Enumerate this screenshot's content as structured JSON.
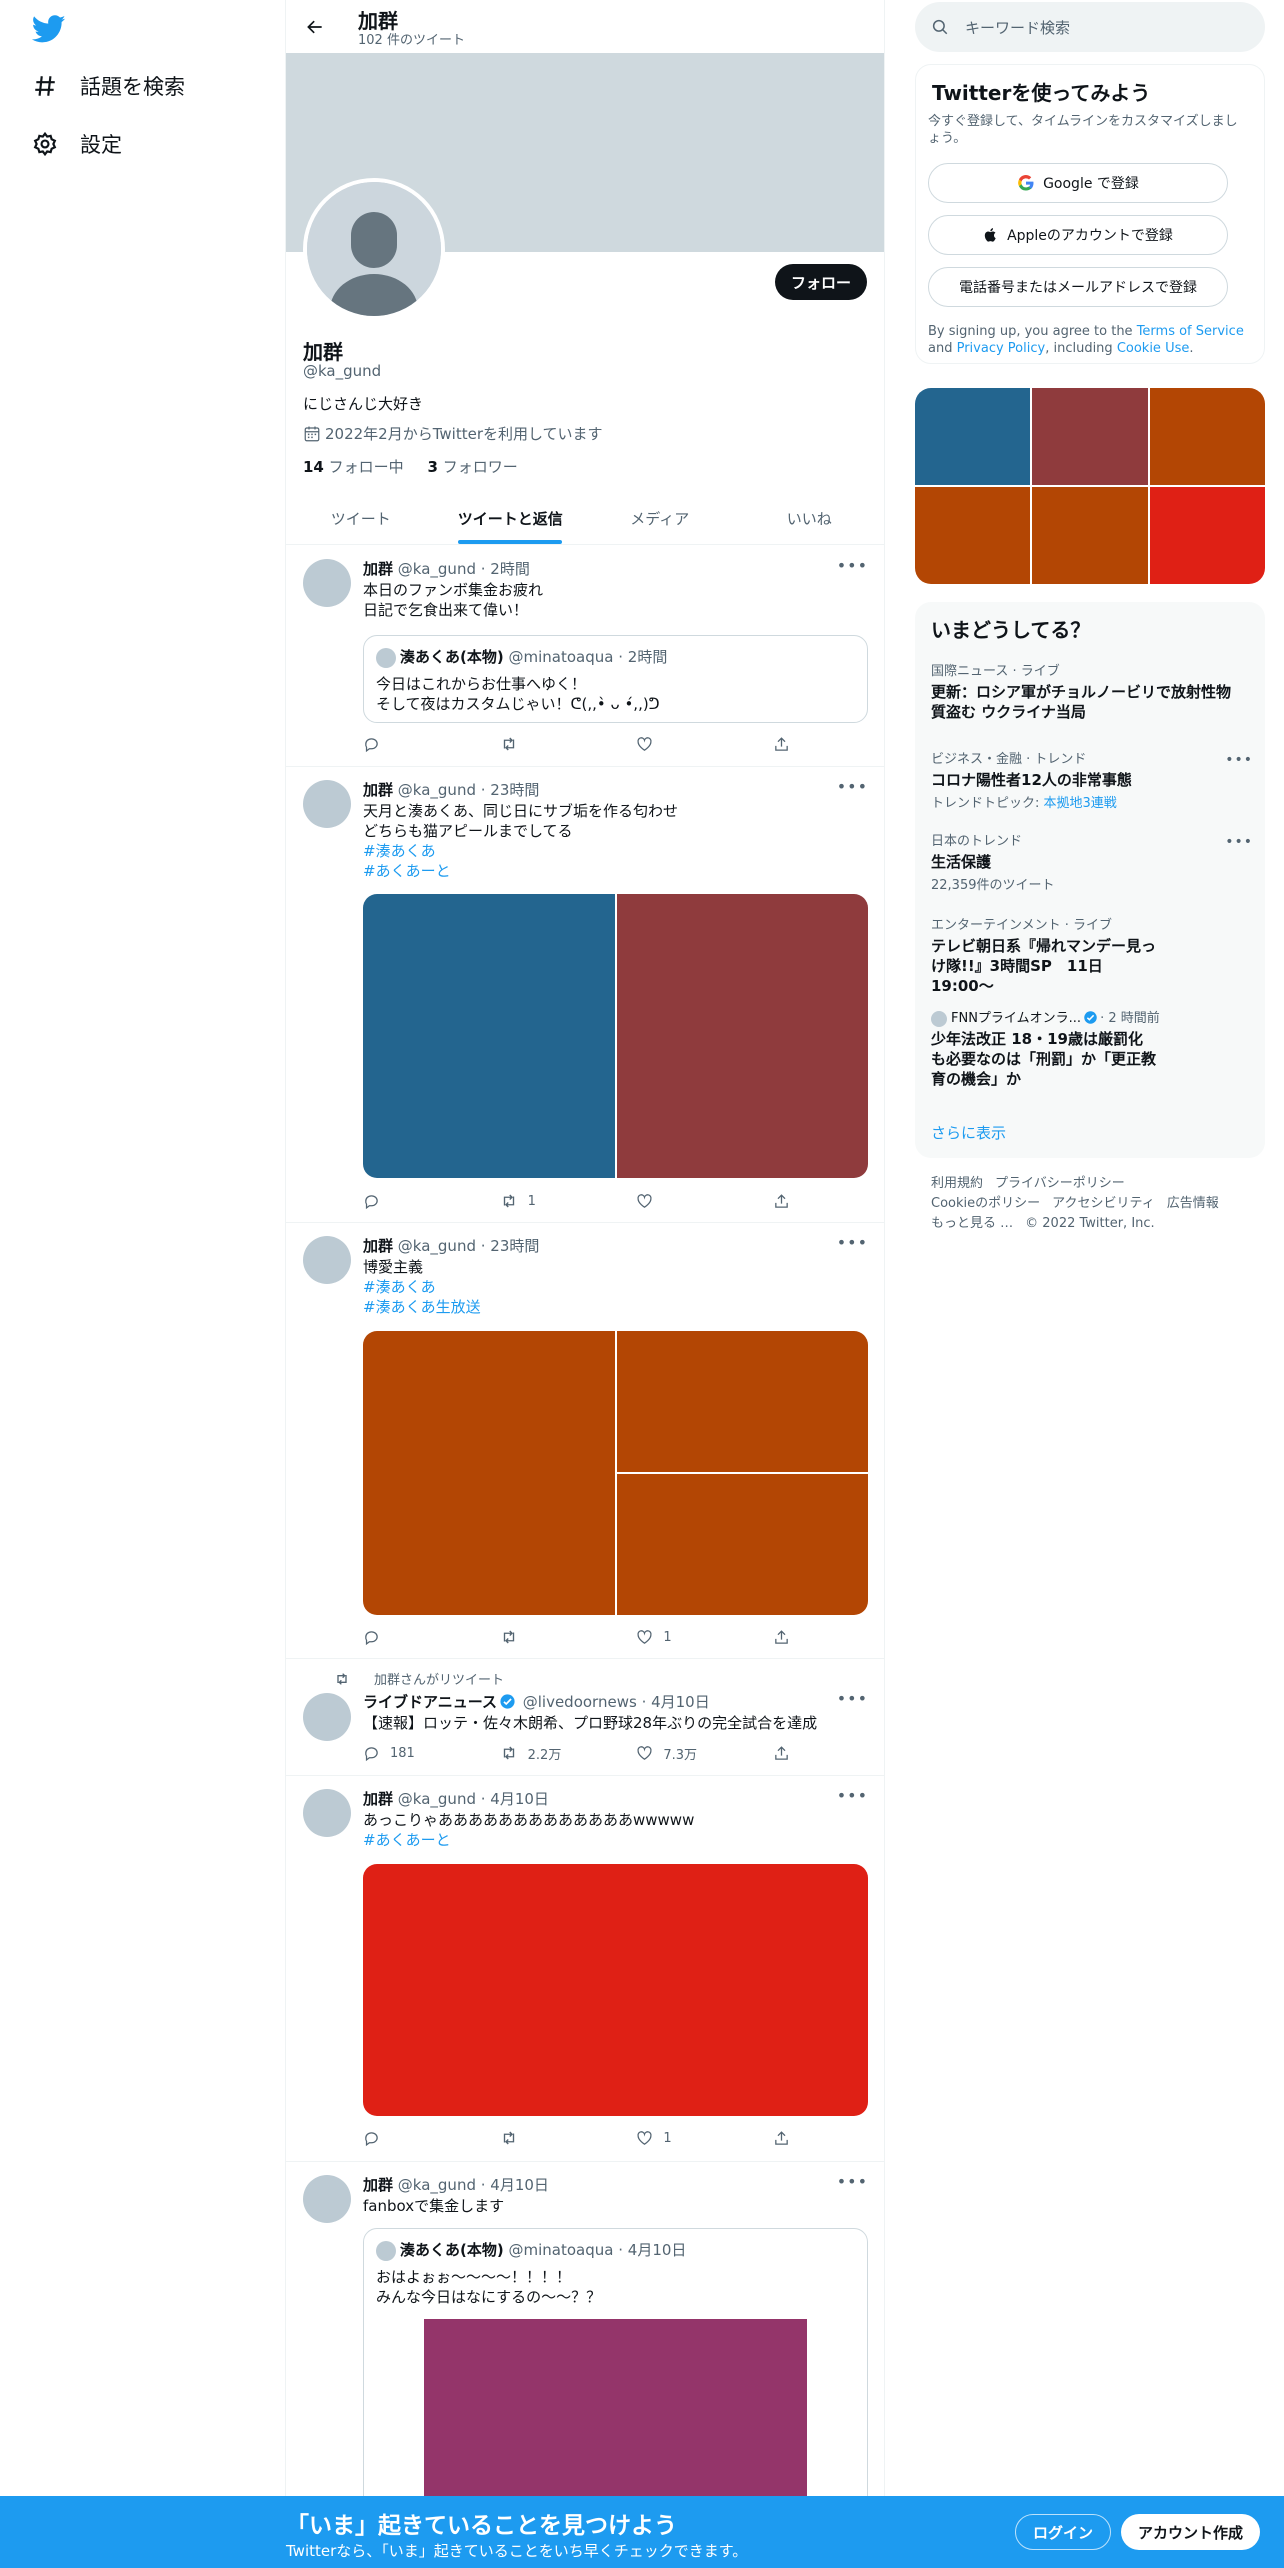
{
  "nav": {
    "items": [
      {
        "label": "話題を検索",
        "icon": "hashtag-icon"
      },
      {
        "label": "設定",
        "icon": "gear-icon"
      }
    ]
  },
  "header": {
    "name": "加群",
    "tweet_count": "102 件のツイート"
  },
  "profile": {
    "name": "加群",
    "handle": "@ka_gund",
    "bio": "にじさんじ大好き",
    "joined": "2022年2月からTwitterを利用しています",
    "following_count": "14",
    "following_label": " フォロー中",
    "followers_count": "3",
    "followers_label": " フォロワー",
    "follow_button": "フォロー"
  },
  "tabs": [
    {
      "label": "ツイート",
      "active": false
    },
    {
      "label": "ツイートと返信",
      "active": true
    },
    {
      "label": "メディア",
      "active": false
    },
    {
      "label": "いいね",
      "active": false
    }
  ],
  "tweets": [
    {
      "author": "加群",
      "handle": "@ka_gund",
      "time": "· 2時間",
      "text": [
        "本日のファンボ集金お疲れ",
        "日記で乞食出来て偉い！"
      ],
      "quote": {
        "author": "湊あくあ(本物)",
        "handle": "@minatoaqua",
        "time": "· 2時間",
        "text": [
          "今日はこれからお仕事へゆく！",
          "そして夜はカスタムじゃい！ᕦ(,,•̀ ᴗ •́,,)ᕤ"
        ]
      },
      "actions": {
        "reply": "",
        "retweet": "",
        "like": ""
      }
    },
    {
      "author": "加群",
      "handle": "@ka_gund",
      "time": "· 23時間",
      "text": [
        "天月と湊あくあ、同じ日にサブ垢を作る匂わせ",
        "どちらも猫アピールまでしてる"
      ],
      "hashtags": [
        "#湊あくあ",
        "#あくあーと"
      ],
      "media_colors": [
        "#23658f",
        "#8f3b3d"
      ],
      "actions": {
        "reply": "",
        "retweet": "1",
        "like": ""
      }
    },
    {
      "author": "加群",
      "handle": "@ka_gund",
      "time": "· 23時間",
      "text": [
        "博愛主義"
      ],
      "hashtags": [
        "#湊あくあ",
        "#湊あくあ生放送"
      ],
      "media_colors": [
        "#b34604",
        "#b34604",
        "#b34604"
      ],
      "actions": {
        "reply": "",
        "retweet": "",
        "like": "1"
      }
    },
    {
      "retweet_label": "加群さんがリツイート",
      "author": "ライブドアニュース",
      "handle": "@livedoornews",
      "time": "· 4月10日",
      "text": [
        "【速報】ロッテ・佐々木朗希、プロ野球28年ぶりの完全試合を達成"
      ],
      "actions": {
        "reply": "181",
        "retweet": "2.2万",
        "like": "7.3万"
      }
    },
    {
      "author": "加群",
      "handle": "@ka_gund",
      "time": "· 4月10日",
      "text": [
        "あっこりゃあああああああああああああwwwww"
      ],
      "hashtags": [
        "#あくあーと"
      ],
      "media_colors": [
        "#df2015"
      ],
      "actions": {
        "reply": "",
        "retweet": "",
        "like": "1"
      }
    },
    {
      "author": "加群",
      "handle": "@ka_gund",
      "time": "· 4月10日",
      "text": [
        "fanboxで集金します"
      ],
      "quote": {
        "author": "湊あくあ(本物)",
        "handle": "@minatoaqua",
        "time": "· 4月10日",
        "text": [
          "おはよぉぉ〜〜〜〜！！！！",
          "みんな今日はなにするの〜〜？？"
        ],
        "media_color": "#94356a"
      }
    }
  ],
  "right": {
    "search_placeholder": "キーワード検索",
    "signup": {
      "title": "Twitterを使ってみよう",
      "subtitle": "今すぐ登録して、タイムラインをカスタマイズしましょう。",
      "google": "Google で登録",
      "apple": "Appleのアカウントで登録",
      "phone": "電話番号またはメールアドレスで登録",
      "legal_prefix": "By signing up, you agree to the ",
      "tos": "Terms of Service",
      "and": " and ",
      "privacy": "Privacy Policy",
      "including": ", including ",
      "cookie": "Cookie Use",
      "period": "."
    },
    "media_grid_colors": [
      "#23658f",
      "#8f3b3d",
      "#b34604",
      "#b34604",
      "#b34604",
      "#df2015"
    ],
    "trends_title": "いまどうしてる？",
    "trends": [
      {
        "category": "国際ニュース · ライブ",
        "title": "更新：ロシア軍がチョルノービリで放射性物質盗む ウクライナ当局"
      },
      {
        "category": "ビジネス・金融 · トレンド",
        "title": "コロナ陽性者12人の非常事態",
        "meta_prefix": "トレンドトピック: ",
        "meta_link": "本拠地3連戦",
        "more": true
      },
      {
        "category": "日本のトレンド",
        "title": "生活保護",
        "meta": "22,359件のツイート",
        "more": true
      },
      {
        "category": "エンターテインメント · ライブ",
        "title": "テレビ朝日系『帰れマンデー見っけ隊!!』3時間SP　11日19:00〜"
      },
      {
        "category_author": "FNNプライムオンラ...",
        "category_time": "· 2 時間前",
        "title": "少年法改正 18・19歳は厳罰化も必要なのは「刑罰」か「更正教育の機会」か"
      }
    ],
    "show_more": "さらに表示",
    "footer": [
      "利用規約",
      "プライバシーポリシー",
      "Cookieのポリシー",
      "アクセシビリティ",
      "広告情報",
      "もっと見る …",
      "© 2022 Twitter, Inc."
    ]
  },
  "bottom_bar": {
    "headline": "「いま」起きていることを見つけよう",
    "sub": "Twitterなら、「いま」起きていることをいち早くチェックできます。",
    "login": "ログイン",
    "signup": "アカウント作成"
  },
  "colors": {
    "accent": "#1d9bf0",
    "text": "#0f1419",
    "muted": "#536471",
    "banner": "#cfd9de"
  }
}
